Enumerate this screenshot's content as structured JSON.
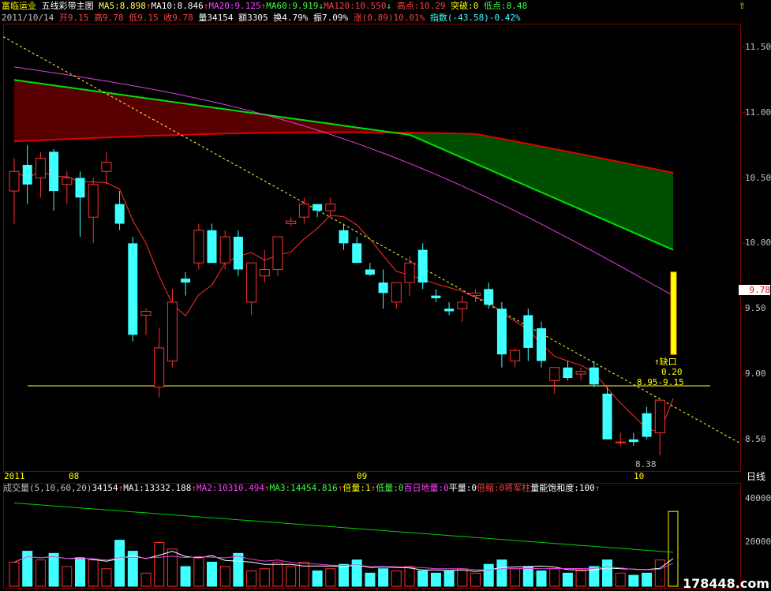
{
  "header": {
    "stock_name": "富临运业",
    "chart_mode": "五线彩带主图",
    "ma_line": [
      {
        "text": "MA5:8.898",
        "color": "#ffff66",
        "arrow": "↑",
        "arrow_color": "#ff4040"
      },
      {
        "text": "MA10:8.846",
        "color": "#ffffff",
        "arrow": "↑",
        "arrow_color": "#ff4040"
      },
      {
        "text": "MA20:9.125",
        "color": "#ff40ff",
        "arrow": "↑",
        "arrow_color": "#ff4040"
      },
      {
        "text": "MA60:9.919",
        "color": "#40ff40",
        "arrow": "↓",
        "arrow_color": "#40ff40"
      },
      {
        "text": "MA120:10.550",
        "color": "#ff4040",
        "arrow": "↓",
        "arrow_color": "#40ff40"
      }
    ],
    "high_point": "高点:10.29",
    "breakout": "突破:0",
    "low_point": "低点:8.48",
    "quote": {
      "date": "2011/10/14",
      "open": "开9.15",
      "high": "高9.78",
      "low": "低9.15",
      "close": "收9.78",
      "volume": "量34154",
      "amount": "额3305",
      "turnover": "换4.79%",
      "amplitude": "振7.09%",
      "change": "涨(0.89)10.01%",
      "index": "指数(-43.58)-0.42%"
    }
  },
  "axis": {
    "price_ticks": [
      "11.50",
      "11.00",
      "10.50",
      "10.00",
      "9.50",
      "9.00",
      "8.50"
    ],
    "volume_ticks": [
      "40000",
      "20000"
    ],
    "current_price_tag": "9.78",
    "period_button": "日线",
    "months": [
      "2011",
      "08",
      "09",
      "10"
    ]
  },
  "annotations": {
    "gap_label": "↑缺口",
    "gap_value": "0.20",
    "gap_range": "8.95-9.15",
    "low_mark": "8.38"
  },
  "volume_header": [
    {
      "text": "成交量(5,10,60,20)",
      "color": "#c0c0c0"
    },
    {
      "text": "34154",
      "color": "#ffffff"
    },
    {
      "text": "↑",
      "color": "#ff4040"
    },
    {
      "text": "MA1:13332.188",
      "color": "#ffffff"
    },
    {
      "text": "↑",
      "color": "#ff4040"
    },
    {
      "text": "MA2:10310.494",
      "color": "#ff40ff"
    },
    {
      "text": "↑",
      "color": "#ff4040"
    },
    {
      "text": "MA3:14454.816",
      "color": "#40ff40"
    },
    {
      "text": "↑",
      "color": "#ff4040"
    },
    {
      "text": "倍量:1",
      "color": "#ffff00"
    },
    {
      "text": "↑",
      "color": "#ff4040"
    },
    {
      "text": "低量:0",
      "color": "#40ff40"
    },
    {
      "text": "百日地量:0",
      "color": "#ff40ff"
    },
    {
      "text": "平量:0",
      "color": "#ffffff"
    },
    {
      "text": "倍缩:0",
      "color": "#ff4040"
    },
    {
      "text": "将军柱",
      "color": "#ff4040"
    },
    {
      "text": "量能饱和度:100",
      "color": "#ffffff"
    },
    {
      "text": "↑",
      "color": "#ff4040"
    }
  ],
  "watermark": "178448.com",
  "colors": {
    "up": "#ff3030",
    "down": "#40ffff",
    "ma60": "#00e000",
    "ma120": "#e00000",
    "ma20": "#e040e0",
    "ma5": "#ffff60",
    "border": "#800000"
  },
  "chart_data": {
    "type": "candlestick",
    "price_range": [
      8.3,
      11.65
    ],
    "volume_range": [
      0,
      45000
    ],
    "ohlc": [
      [
        10.4,
        10.65,
        10.15,
        10.55
      ],
      [
        10.6,
        10.75,
        10.3,
        10.45
      ],
      [
        10.5,
        10.7,
        10.35,
        10.65
      ],
      [
        10.7,
        10.72,
        10.25,
        10.4
      ],
      [
        10.45,
        10.55,
        10.3,
        10.5
      ],
      [
        10.5,
        10.55,
        10.05,
        10.35
      ],
      [
        10.2,
        10.5,
        10.0,
        10.45
      ],
      [
        10.55,
        10.7,
        10.45,
        10.62
      ],
      [
        10.3,
        10.4,
        10.1,
        10.15
      ],
      [
        10.0,
        10.05,
        9.25,
        9.3
      ],
      [
        9.45,
        9.5,
        9.3,
        9.48
      ],
      [
        8.9,
        9.35,
        8.82,
        9.2
      ],
      [
        9.1,
        9.65,
        9.05,
        9.55
      ],
      [
        9.73,
        9.78,
        9.6,
        9.7
      ],
      [
        9.85,
        10.15,
        9.8,
        10.1
      ],
      [
        10.1,
        10.15,
        9.85,
        9.85
      ],
      [
        9.85,
        10.1,
        9.8,
        10.05
      ],
      [
        10.05,
        10.1,
        9.75,
        9.8
      ],
      [
        9.55,
        9.85,
        9.45,
        9.85
      ],
      [
        9.75,
        9.95,
        9.7,
        9.8
      ],
      [
        9.8,
        10.05,
        9.75,
        10.05
      ],
      [
        10.15,
        10.2,
        10.13,
        10.17
      ],
      [
        10.2,
        10.35,
        10.15,
        10.3
      ],
      [
        10.3,
        10.3,
        10.2,
        10.25
      ],
      [
        10.25,
        10.35,
        10.2,
        10.3
      ],
      [
        10.1,
        10.15,
        9.95,
        10.0
      ],
      [
        10.0,
        10.05,
        9.85,
        9.85
      ],
      [
        9.8,
        9.85,
        9.75,
        9.76
      ],
      [
        9.7,
        9.8,
        9.5,
        9.62
      ],
      [
        9.55,
        9.7,
        9.5,
        9.7
      ],
      [
        9.7,
        9.9,
        9.6,
        9.85
      ],
      [
        9.95,
        10.0,
        9.65,
        9.7
      ],
      [
        9.6,
        9.65,
        9.55,
        9.58
      ],
      [
        9.5,
        9.55,
        9.45,
        9.48
      ],
      [
        9.5,
        9.6,
        9.4,
        9.55
      ],
      [
        9.6,
        9.65,
        9.55,
        9.62
      ],
      [
        9.65,
        9.7,
        9.5,
        9.53
      ],
      [
        9.5,
        9.55,
        9.05,
        9.15
      ],
      [
        9.1,
        9.2,
        9.05,
        9.18
      ],
      [
        9.45,
        9.5,
        9.1,
        9.2
      ],
      [
        9.35,
        9.4,
        9.05,
        9.1
      ],
      [
        8.95,
        9.05,
        8.85,
        9.05
      ],
      [
        9.05,
        9.1,
        8.95,
        8.97
      ],
      [
        9.0,
        9.05,
        8.95,
        9.02
      ],
      [
        9.05,
        9.1,
        8.9,
        8.92
      ],
      [
        8.85,
        8.9,
        8.5,
        8.5
      ],
      [
        8.48,
        8.55,
        8.45,
        8.48
      ],
      [
        8.5,
        8.55,
        8.45,
        8.48
      ],
      [
        8.7,
        8.75,
        8.5,
        8.52
      ],
      [
        8.55,
        8.8,
        8.38,
        8.8
      ],
      [
        9.15,
        9.78,
        9.15,
        9.78
      ]
    ],
    "volume": [
      11000,
      16000,
      12000,
      15000,
      9000,
      13000,
      12000,
      8000,
      21000,
      16000,
      6000,
      20000,
      17000,
      9000,
      13000,
      11000,
      9000,
      15000,
      7000,
      8000,
      11000,
      9000,
      11000,
      7000,
      8000,
      10000,
      12000,
      6000,
      8000,
      7000,
      9000,
      7000,
      6000,
      7000,
      8000,
      6000,
      10000,
      12000,
      8000,
      9000,
      7000,
      8000,
      6000,
      7000,
      9000,
      12000,
      6000,
      5000,
      6000,
      12000,
      34154
    ]
  }
}
